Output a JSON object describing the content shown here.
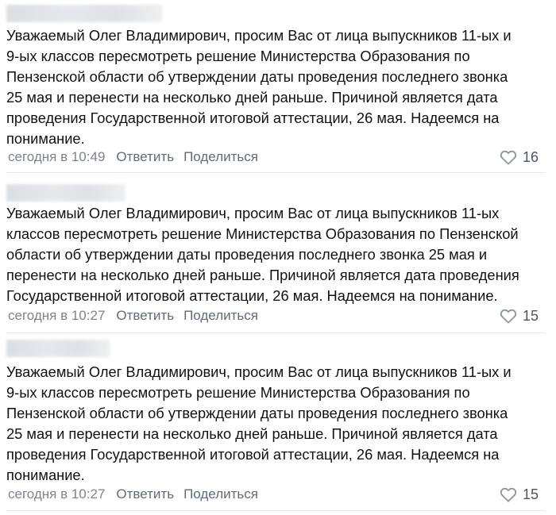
{
  "comments": [
    {
      "text": "Уважаемый Олег Владимирович, просим Вас от лица выпускников 11-ых и\n9-ых классов пересмотреть решение Министерства Образования по\nПензенской области об утверждении даты проведения последнего звонка\n25 мая и перенести на несколько дней раньше. Причиной является дата\nпроведения Государственной итоговой аттестации, 26 мая. Надеемся на\nпонимание.",
      "time": "сегодня в 10:49",
      "reply_label": "Ответить",
      "share_label": "Поделиться",
      "likes": "16"
    },
    {
      "text": "Уважаемый Олег Владимирович, просим Вас от лица выпускников 11-ых\nклассов пересмотреть решение Министерства Образования по Пензенской\nобласти об утверждении даты проведения последнего звонка 25 мая и\nперенести на несколько дней раньше. Причиной является дата проведения\nГосударственной итоговой аттестации, 26 мая. Надеемся на понимание.",
      "time": "сегодня в 10:27",
      "reply_label": "Ответить",
      "share_label": "Поделиться",
      "likes": "15"
    },
    {
      "text": "Уважаемый Олег Владимирович, просим Вас от лица выпускников 11-ых и\n9-ых классов пересмотреть решение Министерства Образования по\nПензенской области об утверждении даты проведения последнего звонка\n25 мая и перенести на несколько дней раньше. Причиной является дата\nпроведения Государственной итоговой аттестации, 26 мая. Надеемся на\nпонимание.",
      "time": "сегодня в 10:27",
      "reply_label": "Ответить",
      "share_label": "Поделиться",
      "likes": "15"
    }
  ],
  "icons": {
    "like": "heart-outline-icon"
  },
  "colors": {
    "meta_text": "#7b848f",
    "action_text": "#5f6b78",
    "like_count": "#4b5663",
    "divider": "#e3e6e9"
  }
}
